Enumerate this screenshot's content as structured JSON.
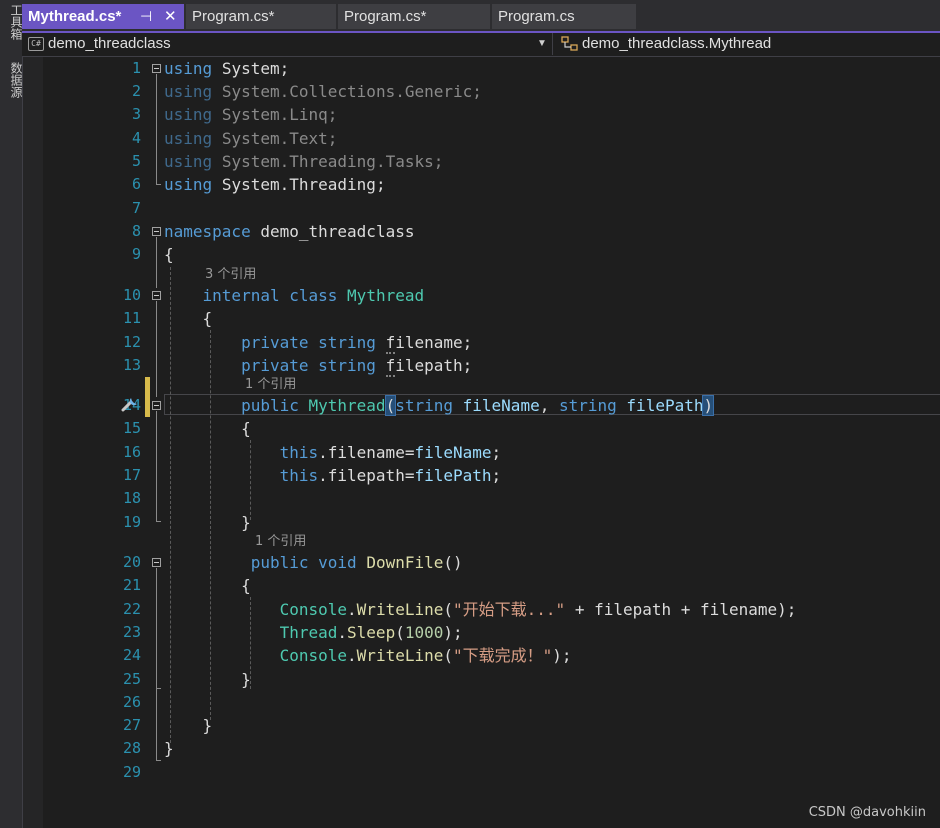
{
  "side_tabs": [
    "工具箱",
    "数据源"
  ],
  "tabs": [
    {
      "label": "Mythread.cs*",
      "active": true,
      "pin": "⊣",
      "close": "✕"
    },
    {
      "label": "Program.cs*"
    },
    {
      "label": "Program.cs*"
    },
    {
      "label": "Program.cs"
    }
  ],
  "nav": {
    "project": "demo_threadclass",
    "project_icon": "C#",
    "member": "demo_threadclass.Mythread"
  },
  "codelens": {
    "refs_3": "3 个引用",
    "refs_1a": "1 个引用",
    "refs_1b": "1 个引用"
  },
  "lines": [
    {
      "n": "1"
    },
    {
      "n": "2"
    },
    {
      "n": "3"
    },
    {
      "n": "4"
    },
    {
      "n": "5"
    },
    {
      "n": "6"
    },
    {
      "n": "7"
    },
    {
      "n": "8"
    },
    {
      "n": "9"
    },
    {
      "n": "10"
    },
    {
      "n": "11"
    },
    {
      "n": "12"
    },
    {
      "n": "13"
    },
    {
      "n": "14"
    },
    {
      "n": "15"
    },
    {
      "n": "16"
    },
    {
      "n": "17"
    },
    {
      "n": "18"
    },
    {
      "n": "19"
    },
    {
      "n": "20"
    },
    {
      "n": "21"
    },
    {
      "n": "22"
    },
    {
      "n": "23"
    },
    {
      "n": "24"
    },
    {
      "n": "25"
    },
    {
      "n": "26"
    },
    {
      "n": "27"
    },
    {
      "n": "28"
    },
    {
      "n": "29"
    }
  ],
  "tokens": {
    "using": "using",
    "system": "System;",
    "system_cg_a": "System.Collections.Generic;",
    "system_linq": "System.Linq;",
    "system_text": "System.Text;",
    "system_tasks": "System.Threading.Tasks;",
    "system_threading": "System.Threading;",
    "namespace": "namespace",
    "ns_name": "demo_threadclass",
    "open_brace": "{",
    "close_brace": "}",
    "internal": "internal",
    "class": "class",
    "class_name": "Mythread",
    "private": "private",
    "string": "string",
    "f_filename_first": "f",
    "f_filename_rest": "ilename;",
    "f_filepath_first": "f",
    "f_filepath_rest": "ilepath;",
    "public": "public",
    "ctor_name": "Mythread",
    "lparen": "(",
    "rparen": ")",
    "p_fileName": "fileName",
    "comma": ",",
    "p_filePath": "filePath",
    "this": "this",
    "assign_filename": ".filename=",
    "assign_filepath": ".filepath=",
    "semicolon": ";",
    "void": "void",
    "downfile": "DownFile",
    "empty_parens": "()",
    "console": "Console",
    "writeline": "WriteLine",
    "dot": ".",
    "str_start": "\"开始下载...\"",
    "concat_tail": " + filepath + filename);",
    "thread": "Thread",
    "sleep": "Sleep",
    "num_1000": "1000",
    "close_stmt": ");",
    "str_done": "\"下载完成！\""
  },
  "watermark": "CSDN @davohkiin"
}
